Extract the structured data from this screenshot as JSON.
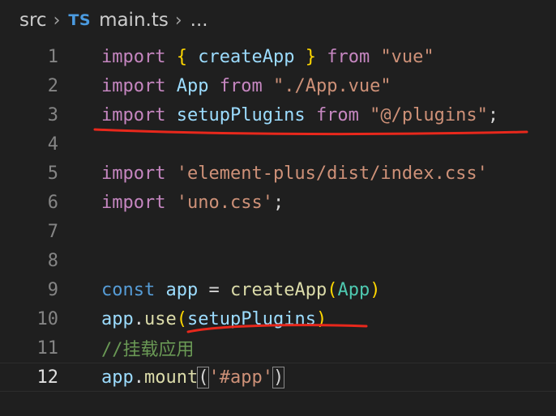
{
  "breadcrumb": {
    "folder": "src",
    "file_type": "TS",
    "file": "main.ts",
    "more": "..."
  },
  "editor": {
    "current_line": "12",
    "lines": [
      {
        "num": "1",
        "tokens": {
          "kw": "import",
          "b1": "{",
          "name": "createApp",
          "b2": "}",
          "from": "from",
          "path": "\"vue\""
        }
      },
      {
        "num": "2",
        "tokens": {
          "kw": "import",
          "name": "App",
          "from": "from",
          "path": "\"./App.vue\""
        }
      },
      {
        "num": "3",
        "tokens": {
          "kw": "import",
          "name": "setupPlugins",
          "from": "from",
          "path": "\"@/plugins\"",
          "semi": ";"
        }
      },
      {
        "num": "4"
      },
      {
        "num": "5",
        "tokens": {
          "kw": "import",
          "path": "'element-plus/dist/index.css'"
        }
      },
      {
        "num": "6",
        "tokens": {
          "kw": "import",
          "path": "'uno.css'",
          "semi": ";"
        }
      },
      {
        "num": "7"
      },
      {
        "num": "8"
      },
      {
        "num": "9",
        "tokens": {
          "kw": "const",
          "name": "app",
          "op": "=",
          "fn": "createApp",
          "lp": "(",
          "arg": "App",
          "rp": ")"
        }
      },
      {
        "num": "10",
        "tokens": {
          "obj": "app",
          "dot": ".",
          "fn": "use",
          "lp": "(",
          "arg": "setupPlugins",
          "rp": ")"
        }
      },
      {
        "num": "11",
        "tokens": {
          "comment": "//挂载应用"
        }
      },
      {
        "num": "12",
        "tokens": {
          "obj": "app",
          "dot": ".",
          "fn": "mount",
          "lp": "(",
          "arg": "'#app'",
          "rp": ")"
        }
      }
    ]
  },
  "colors": {
    "annotation": "#e8281c",
    "background": "#1f1f1f"
  }
}
